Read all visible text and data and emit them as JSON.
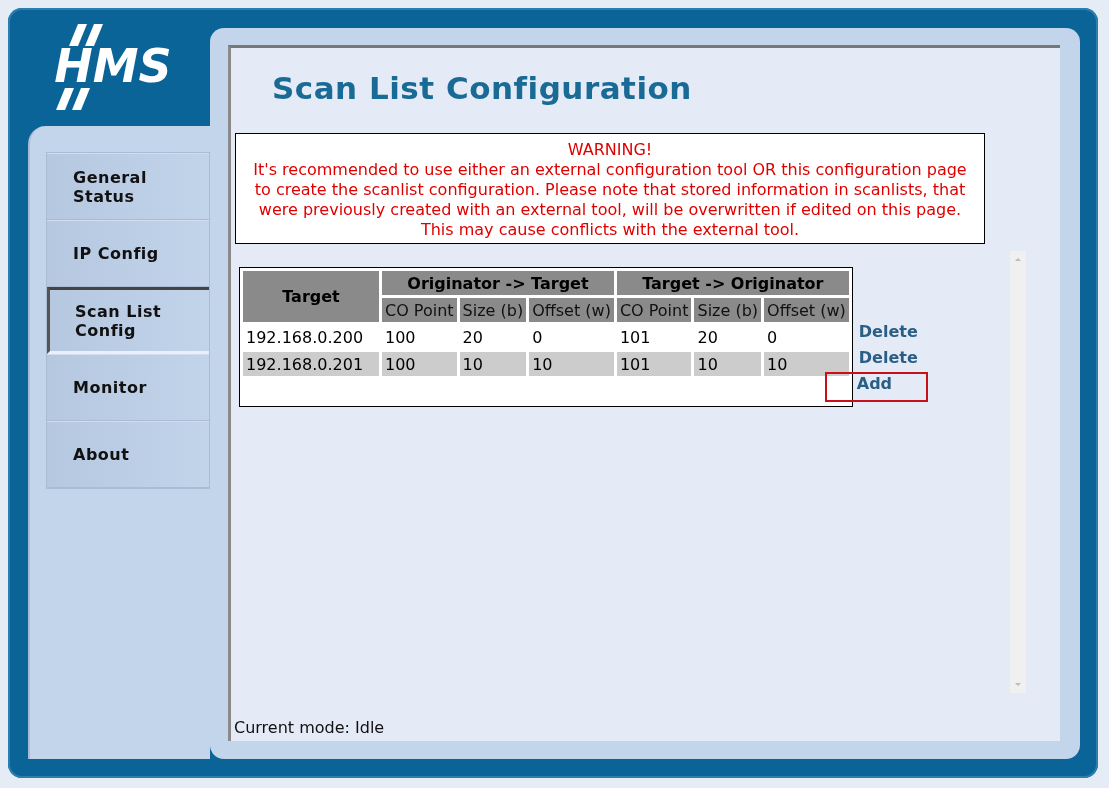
{
  "logo": "HMS",
  "nav": [
    {
      "label": "General Status",
      "selected": false
    },
    {
      "label": "IP Config",
      "selected": false
    },
    {
      "label": "Scan List Config",
      "selected": true
    },
    {
      "label": "Monitor",
      "selected": false
    },
    {
      "label": "About",
      "selected": false
    }
  ],
  "title": "Scan List Configuration",
  "warning": {
    "heading": "WARNING!",
    "lines": [
      "It's recommended to use either an external configuration tool OR this configuration page",
      "to create the scanlist configuration. Please note that stored information in scanlists, that",
      "were previously created with an external tool, will be overwritten if edited on this page.",
      "This may cause conflicts with the external tool."
    ]
  },
  "table": {
    "target_header": "Target",
    "groups": [
      "Originator -> Target",
      "Target -> Originator"
    ],
    "columns": [
      "",
      "CO Point",
      "Size (b)",
      "Offset (w)",
      "CO Point",
      "Size (b)",
      "Offset (w)"
    ],
    "rows": [
      {
        "cells": [
          "192.168.0.200",
          "100",
          "20",
          "0",
          "101",
          "20",
          "0"
        ],
        "action": "Delete"
      },
      {
        "cells": [
          "192.168.0.201",
          "100",
          "10",
          "10",
          "101",
          "10",
          "10"
        ],
        "action": "Delete"
      }
    ]
  },
  "add_action": {
    "label": "Add",
    "highlighted": true
  },
  "status": "Current mode: Idle"
}
